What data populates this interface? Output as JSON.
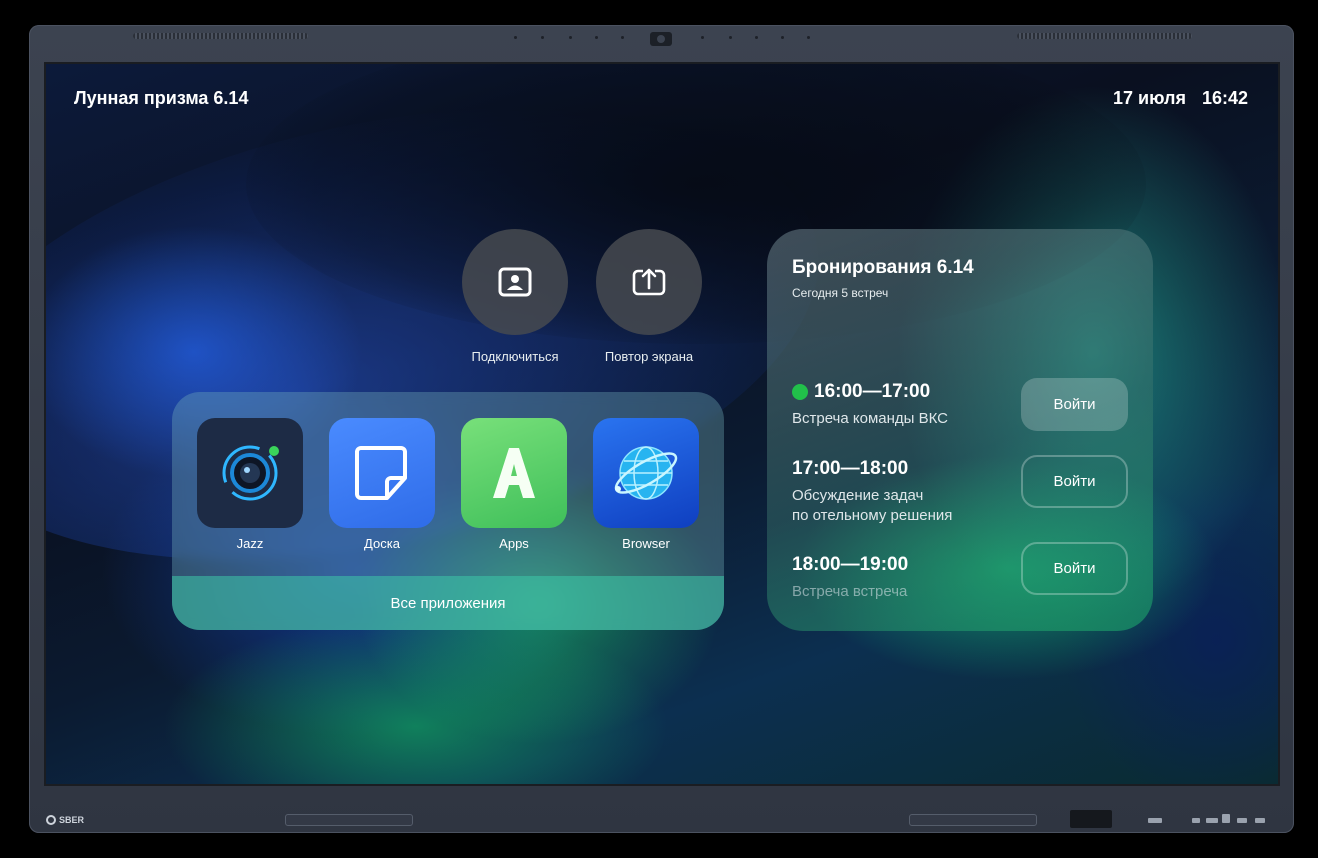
{
  "status_bar": {
    "room_name": "Лунная призма 6.14",
    "date": "17 июля",
    "time": "16:42"
  },
  "quick_actions": [
    {
      "label": "Подключиться",
      "icon": "contact-card-icon"
    },
    {
      "label": "Повтор экрана",
      "icon": "screen-share-icon"
    }
  ],
  "apps": [
    {
      "label": "Jazz",
      "icon": "jazz-camera-icon"
    },
    {
      "label": "Доска",
      "icon": "whiteboard-icon"
    },
    {
      "label": "Apps",
      "icon": "apps-store-icon"
    },
    {
      "label": "Browser",
      "icon": "browser-globe-icon"
    }
  ],
  "all_apps_label": "Все приложения",
  "booking": {
    "title": "Бронирования 6.14",
    "subtitle": "Сегодня 5 встреч",
    "meetings": [
      {
        "time": "16:00—17:00",
        "desc": "Встреча команды ВКС",
        "join_label": "Войти",
        "active": true
      },
      {
        "time": "17:00—18:00",
        "desc1": "Обсуждение задач",
        "desc2": "по отельному решения",
        "join_label": "Войти",
        "active": false
      },
      {
        "time": "18:00—19:00",
        "desc": "Встреча встреча",
        "join_label": "Войти",
        "active": false
      }
    ]
  },
  "device": {
    "brand": "SBER"
  },
  "colors": {
    "live_indicator": "#21c04a",
    "bezel": "#3c4350",
    "doska_tile": "#3d7bf0",
    "apps_tile": "#5fd36a",
    "browser_tile": "#1657d8",
    "jazz_tile": "#1d2b45"
  }
}
